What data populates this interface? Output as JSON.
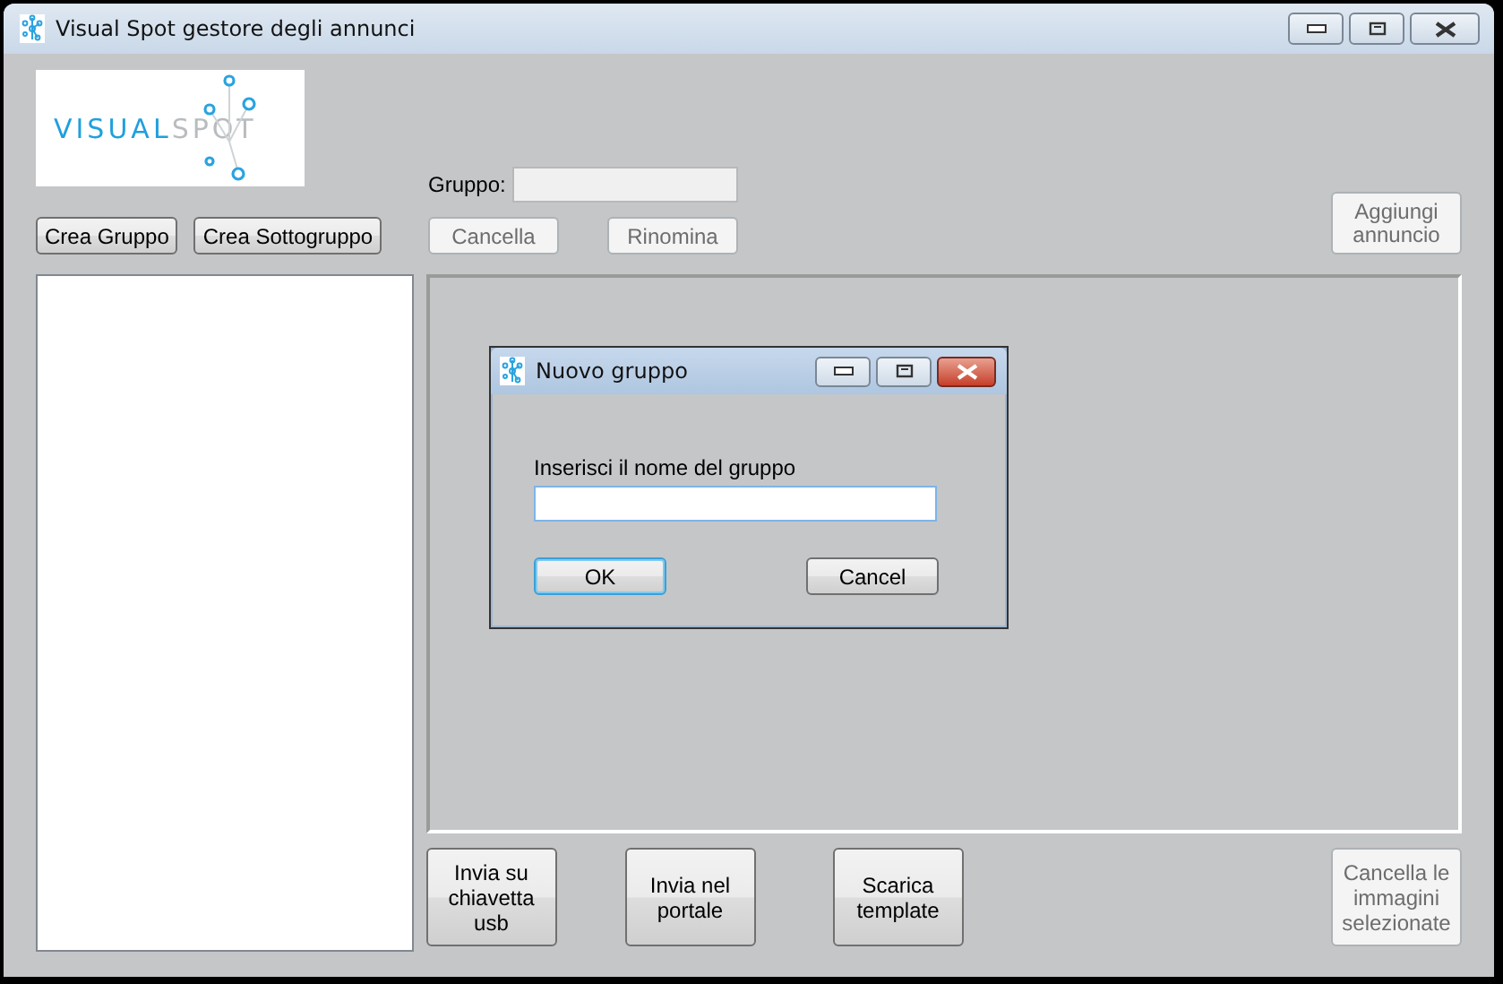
{
  "window": {
    "title": "Visual Spot gestore degli annunci"
  },
  "logo": {
    "text_1": "VISUAL",
    "text_2": "SPOT"
  },
  "tree_buttons": [
    {
      "label": "Crea Gruppo",
      "disabled": false
    },
    {
      "label": "Crea Sottogruppo",
      "disabled": false
    }
  ],
  "group_field": {
    "label": "Gruppo:",
    "disabled": true
  },
  "group_buttons": [
    {
      "label": "Cancella",
      "disabled": true
    },
    {
      "label": "Rinomina",
      "disabled": true
    }
  ],
  "add_button": {
    "label": "Aggiungi annuncio",
    "disabled": true
  },
  "bottom_buttons": [
    {
      "label": "Invia su chiavetta usb",
      "disabled": false
    },
    {
      "label": "Invia nel portale",
      "disabled": false
    },
    {
      "label": "Scarica template",
      "disabled": false
    },
    {
      "label": "Cancella le immagini selezionate",
      "disabled": true
    }
  ],
  "dialog": {
    "title": "Nuovo gruppo",
    "prompt": "Inserisci il nome del gruppo",
    "buttons": [
      {
        "label": "OK",
        "selected": true
      },
      {
        "label": "Cancel",
        "selected": false
      }
    ]
  }
}
